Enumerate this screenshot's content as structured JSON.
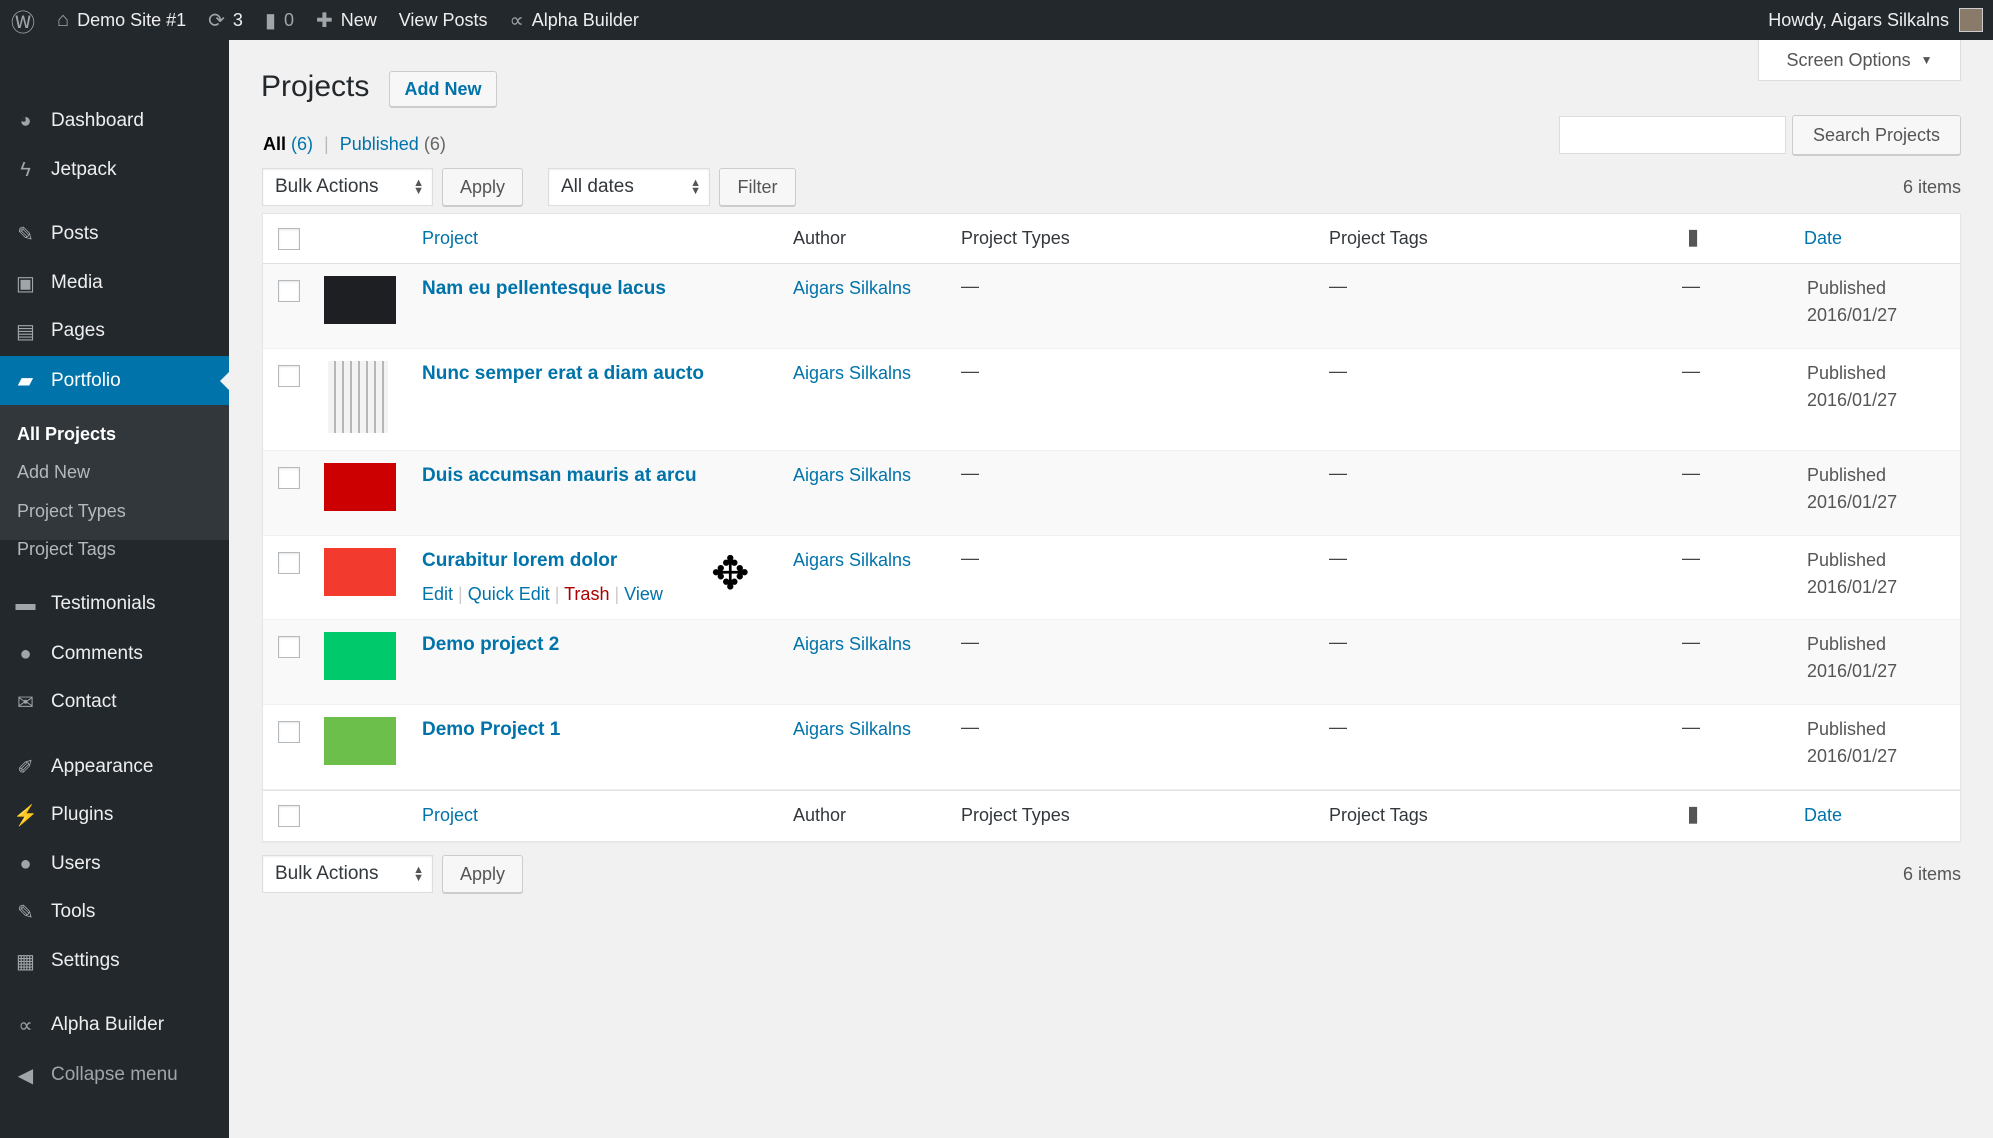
{
  "adminbar": {
    "site": "Demo Site #1",
    "updates": "3",
    "comments": "0",
    "new": "New",
    "view_posts": "View Posts",
    "builder": "Alpha Builder",
    "howdy": "Howdy, Aigars Silkalns"
  },
  "sidebar": {
    "items": [
      "Dashboard",
      "Jetpack",
      "Posts",
      "Media",
      "Pages",
      "Portfolio",
      "Testimonials",
      "Comments",
      "Contact",
      "Appearance",
      "Plugins",
      "Users",
      "Tools",
      "Settings",
      "Alpha Builder",
      "Collapse menu"
    ],
    "submenu": [
      "All Projects",
      "Add New",
      "Project Types",
      "Project Tags"
    ]
  },
  "page": {
    "title": "Projects",
    "add_new": "Add New",
    "screen_options": "Screen Options",
    "filter_all": "All",
    "filter_all_count": "(6)",
    "filter_published": "Published",
    "filter_published_count": "(6)",
    "search_button": "Search Projects",
    "search_value": "",
    "bulk_actions": "Bulk Actions",
    "apply": "Apply",
    "all_dates": "All dates",
    "filter": "Filter",
    "items_count": "6 items"
  },
  "table": {
    "columns": {
      "project": "Project",
      "author": "Author",
      "types": "Project Types",
      "tags": "Project Tags",
      "date": "Date"
    },
    "row_actions": {
      "edit": "Edit",
      "quick_edit": "Quick Edit",
      "trash": "Trash",
      "view": "View"
    },
    "rows": [
      {
        "title": "Nam eu pellentesque lacus",
        "author": "Aigars Silkalns",
        "types": "—",
        "tags": "—",
        "comments": "—",
        "status": "Published",
        "date": "2016/01/27",
        "thumb": "#1d1f22"
      },
      {
        "title": "Nunc semper erat a diam aucto",
        "author": "Aigars Silkalns",
        "types": "—",
        "tags": "—",
        "comments": "—",
        "status": "Published",
        "date": "2016/01/27",
        "thumb": "#eeeeee"
      },
      {
        "title": "Duis accumsan mauris at arcu",
        "author": "Aigars Silkalns",
        "types": "—",
        "tags": "—",
        "comments": "—",
        "status": "Published",
        "date": "2016/01/27",
        "thumb": "#cc0000"
      },
      {
        "title": "Curabitur lorem dolor",
        "author": "Aigars Silkalns",
        "types": "—",
        "tags": "—",
        "comments": "—",
        "status": "Published",
        "date": "2016/01/27",
        "thumb": "#f23a2f"
      },
      {
        "title": "Demo project 2",
        "author": "Aigars Silkalns",
        "types": "—",
        "tags": "—",
        "comments": "—",
        "status": "Published",
        "date": "2016/01/27",
        "thumb": "#00c96b"
      },
      {
        "title": "Demo Project 1",
        "author": "Aigars Silkalns",
        "types": "—",
        "tags": "—",
        "comments": "—",
        "status": "Published",
        "date": "2016/01/27",
        "thumb": "#6cbf4a"
      }
    ]
  },
  "colors": {
    "accent": "#0073aa",
    "adminbar": "#23282d",
    "trash": "#a00"
  }
}
